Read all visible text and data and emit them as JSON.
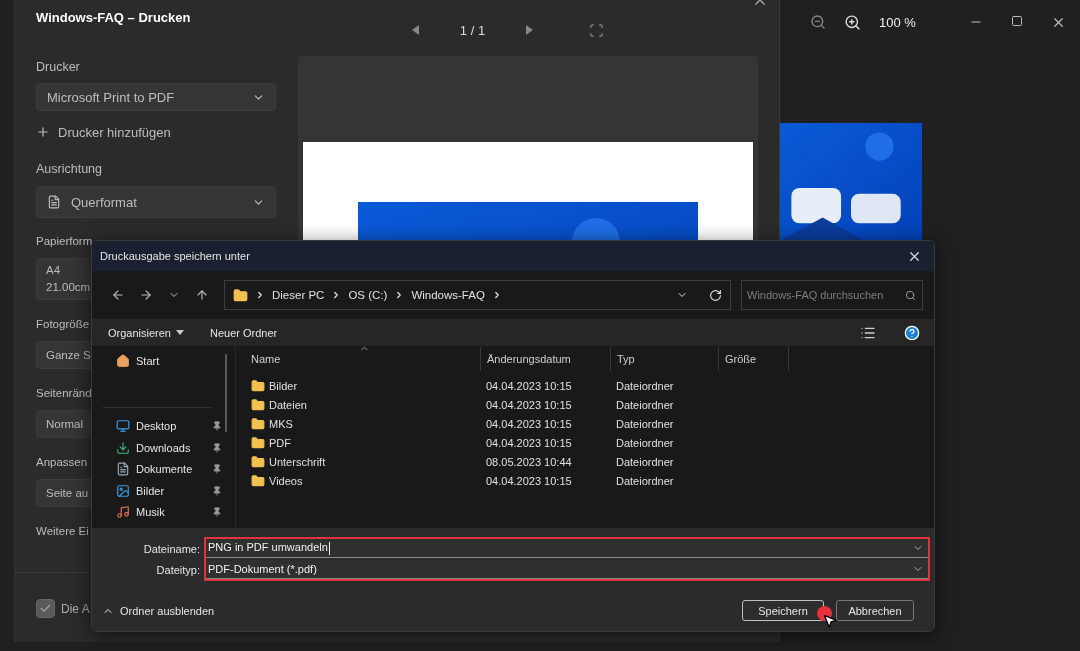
{
  "photo_viewer": {
    "zoom_level": "100 %"
  },
  "print_dialog": {
    "title": "Windows-FAQ – Drucken",
    "page_indicator": "1 / 1",
    "printer": {
      "label": "Drucker",
      "value": "Microsoft Print to PDF"
    },
    "add_printer": "Drucker hinzufügen",
    "orientation": {
      "label": "Ausrichtung",
      "value": "Querformat"
    },
    "settings": [
      {
        "label": "Papierform",
        "lines": [
          "A4",
          "21.00cm"
        ]
      },
      {
        "label": "Fotogröße",
        "lines": [
          "Ganze S"
        ]
      },
      {
        "label": "Seitenränd",
        "lines": [
          "Normal"
        ]
      },
      {
        "label": "Anpassen",
        "lines": [
          "Seite au"
        ]
      }
    ],
    "more_settings": "Weitere Ei",
    "checkbox": {
      "label": "Die A",
      "checked": true
    }
  },
  "save_dialog": {
    "title": "Druckausgabe speichern unter",
    "path": [
      "Dieser PC",
      "OS (C:)",
      "Windows-FAQ"
    ],
    "search": {
      "placeholder": "Windows-FAQ durchsuchen"
    },
    "commands": [
      {
        "label": "Organisieren",
        "kind": "menu"
      },
      {
        "label": "Neuer Ordner",
        "kind": "button"
      }
    ],
    "home": {
      "label": "Start",
      "kind": "home"
    },
    "quick_access": [
      {
        "label": "Desktop",
        "kind": "desktop",
        "pinned": true
      },
      {
        "label": "Downloads",
        "kind": "download",
        "pinned": true
      },
      {
        "label": "Dokumente",
        "kind": "documents",
        "pinned": true
      },
      {
        "label": "Bilder",
        "kind": "pictures",
        "pinned": true
      },
      {
        "label": "Musik",
        "kind": "music",
        "pinned": true
      }
    ],
    "table": {
      "columns": [
        "Name",
        "Änderungsdatum",
        "Typ",
        "Größe"
      ],
      "rows": [
        {
          "name": "Bilder",
          "modified": "04.04.2023 10:15",
          "type": "Dateiordner"
        },
        {
          "name": "Dateien",
          "modified": "04.04.2023 10:15",
          "type": "Dateiordner"
        },
        {
          "name": "MKS",
          "modified": "04.04.2023 10:15",
          "type": "Dateiordner"
        },
        {
          "name": "PDF",
          "modified": "04.04.2023 10:15",
          "type": "Dateiordner"
        },
        {
          "name": "Unterschrift",
          "modified": "08.05.2023 10:44",
          "type": "Dateiordner"
        },
        {
          "name": "Videos",
          "modified": "04.04.2023 10:15",
          "type": "Dateiordner"
        }
      ]
    },
    "file_name": {
      "label": "Dateiname:",
      "value": "PNG in PDF umwandeln"
    },
    "file_type": {
      "label": "Dateityp:",
      "value": "PDF-Dokument (*.pdf)"
    },
    "toggle_folders": "Ordner ausblenden",
    "buttons": [
      {
        "label": "Speichern",
        "default": true
      },
      {
        "label": "Abbrechen",
        "default": false
      }
    ]
  }
}
